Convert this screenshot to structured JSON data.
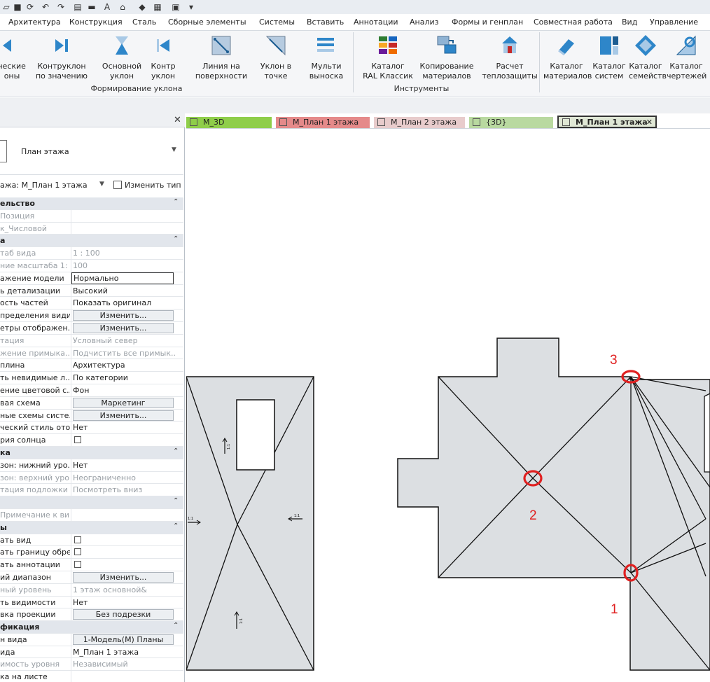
{
  "menu_tabs": [
    "Архитектура",
    "Конструкция",
    "Сталь",
    "Сборные элементы",
    "Системы",
    "Вставить",
    "Аннотации",
    "Анализ",
    "Формы и генплан",
    "Совместная работа",
    "Вид",
    "Управление"
  ],
  "ribbon": {
    "tools": [
      {
        "l1": "ческие",
        "l2": "оны",
        "icon": "arrow-left-icon"
      },
      {
        "l1": "Контруклон",
        "l2": "по значению",
        "icon": "arrow-right-icon"
      },
      {
        "l1": "Основной",
        "l2": "уклон",
        "icon": "slope-icon"
      },
      {
        "l1": "Контр",
        "l2": "уклон",
        "icon": "counter-slope-icon"
      },
      {
        "l1": "Линия на",
        "l2": "поверхности",
        "icon": "surface-line-icon"
      },
      {
        "l1": "Уклон в",
        "l2": "точке",
        "icon": "point-slope-icon"
      },
      {
        "l1": "Мульти",
        "l2": "выноска",
        "icon": "multi-leader-icon"
      },
      {
        "l1": "Каталог",
        "l2": "RAL Классик",
        "icon": "ral-catalog-icon"
      },
      {
        "l1": "Копирование",
        "l2": "материалов",
        "icon": "copy-materials-icon"
      },
      {
        "l1": "Расчет",
        "l2": "теплозащиты",
        "icon": "thermal-calc-icon"
      },
      {
        "l1": "Каталог",
        "l2": "материалов",
        "icon": "materials-catalog-icon"
      },
      {
        "l1": "Каталог",
        "l2": "систем",
        "icon": "systems-catalog-icon"
      },
      {
        "l1": "Каталог",
        "l2": "семейств",
        "icon": "families-catalog-icon"
      },
      {
        "l1": "Каталог",
        "l2": "чертежей",
        "icon": "drawings-catalog-icon"
      }
    ],
    "group_slope": "Формирование уклона",
    "group_tools": "Инструменты"
  },
  "properties": {
    "close": "✕",
    "type_name": "План этажа",
    "instance_selector": "ажа: М_План 1 этажа",
    "edit_type": "Изменить тип",
    "rows": [
      {
        "kind": "sec",
        "name": "ельство"
      },
      {
        "kind": "row",
        "name": "Позиция",
        "value": "",
        "gray": true
      },
      {
        "kind": "row",
        "name": "к_Числовой",
        "value": "",
        "gray": true
      },
      {
        "kind": "sec",
        "name": "а"
      },
      {
        "kind": "row",
        "name": "таб вида",
        "value": "1 : 100",
        "gray": true
      },
      {
        "kind": "row",
        "name": "ние масштаба   1:",
        "value": "100",
        "gray": true
      },
      {
        "kind": "input",
        "name": "ажение модели",
        "value": "Нормально"
      },
      {
        "kind": "row",
        "name": "ь детализации",
        "value": "Высокий"
      },
      {
        "kind": "row",
        "name": "ость частей",
        "value": "Показать оригинал"
      },
      {
        "kind": "btn",
        "name": "пределения види...",
        "value": "Изменить..."
      },
      {
        "kind": "btn",
        "name": "етры отображен...",
        "value": "Изменить..."
      },
      {
        "kind": "row",
        "name": "тация",
        "value": "Условный север",
        "gray": true
      },
      {
        "kind": "row",
        "name": "жение примыка...",
        "value": "Подчистить все примык...",
        "gray": true
      },
      {
        "kind": "row",
        "name": "плина",
        "value": "Архитектура"
      },
      {
        "kind": "row",
        "name": "ть невидимые л...",
        "value": "По категории"
      },
      {
        "kind": "row",
        "name": "ение цветовой с...",
        "value": "Фон"
      },
      {
        "kind": "btn",
        "name": "вая схема",
        "value": "Маркетинг"
      },
      {
        "kind": "btn",
        "name": "ные схемы систе...",
        "value": "Изменить..."
      },
      {
        "kind": "row",
        "name": "ческий стиль ото...",
        "value": "Нет"
      },
      {
        "kind": "chk",
        "name": "рия солнца"
      },
      {
        "kind": "sec",
        "name": "ка"
      },
      {
        "kind": "row",
        "name": "зон: нижний уро...",
        "value": "Нет"
      },
      {
        "kind": "row",
        "name": "зон: верхний уро...",
        "value": "Неограниченно",
        "gray": true
      },
      {
        "kind": "row",
        "name": "тация подложки",
        "value": "Посмотреть вниз",
        "gray": true
      },
      {
        "kind": "sec",
        "name": ""
      },
      {
        "kind": "row",
        "name": "Примечание к ви...",
        "value": "",
        "gray": true
      },
      {
        "kind": "sec",
        "name": "ы"
      },
      {
        "kind": "chk",
        "name": "ать вид"
      },
      {
        "kind": "chk",
        "name": "ать границу обре..."
      },
      {
        "kind": "chk",
        "name": "ать аннотации"
      },
      {
        "kind": "btn",
        "name": "ий диапазон",
        "value": "Изменить..."
      },
      {
        "kind": "row",
        "name": "ный уровень",
        "value": "1 этаж основной&",
        "gray": true
      },
      {
        "kind": "row",
        "name": "ть видимости",
        "value": "Нет"
      },
      {
        "kind": "btn",
        "name": "вка проекции",
        "value": "Без подрезки"
      },
      {
        "kind": "sec",
        "name": "фикация"
      },
      {
        "kind": "btn",
        "name": "н вида",
        "value": "1-Модель(М) Планы"
      },
      {
        "kind": "row",
        "name": "ида",
        "value": "М_План 1 этажа"
      },
      {
        "kind": "row",
        "name": "имость уровня",
        "value": "Независимый",
        "gray": true
      },
      {
        "kind": "row",
        "name": "ка на листе",
        "value": ""
      }
    ]
  },
  "view_tabs": [
    {
      "label": "М_3D",
      "bg": "#8fce4a",
      "active": false
    },
    {
      "label": "М_План 1 этажа",
      "bg": "#e58a8a",
      "active": false
    },
    {
      "label": "М_План 2 этажа",
      "bg": "#e8cccc",
      "active": false
    },
    {
      "label": "{3D}",
      "bg": "#b9d9a0",
      "active": false
    },
    {
      "label": "М_План 1 этажа",
      "bg": "#dfe7d5",
      "active": true
    }
  ],
  "view_tab_close": "✕",
  "markers": [
    "1",
    "2",
    "3"
  ],
  "slope_tag": "1:1"
}
